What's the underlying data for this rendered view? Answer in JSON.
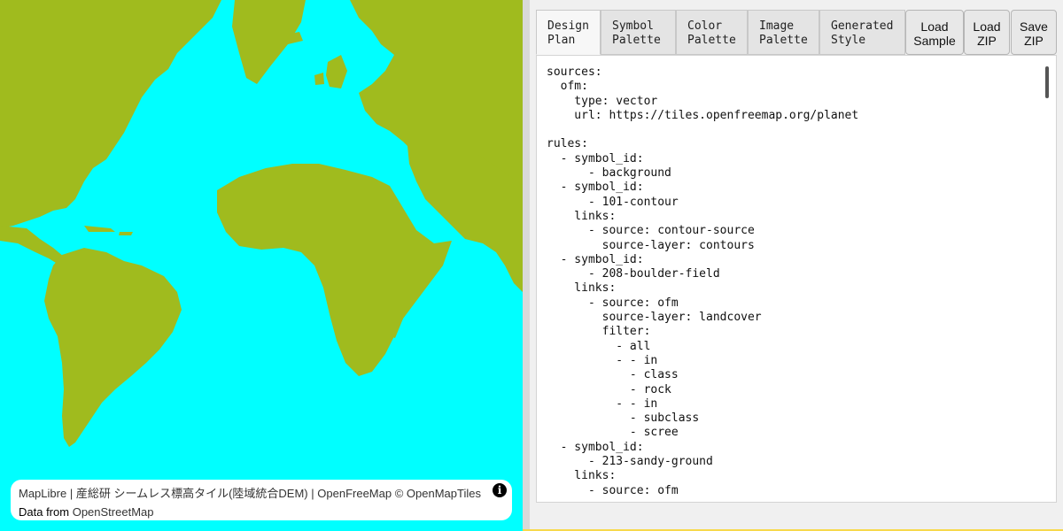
{
  "map": {
    "attribution_line1": [
      "MapLibre",
      "産総研 シームレス標高タイル(陸域統合DEM)",
      "OpenFreeMap",
      "© OpenMapTiles"
    ],
    "separator": "|",
    "data_from_label": "Data from",
    "data_from_link": "OpenStreetMap",
    "info_icon": "i",
    "colors": {
      "water": "#00ffff",
      "land": "#a0bb1e"
    }
  },
  "panel": {
    "tabs": [
      {
        "label": "Design\nPlan",
        "active": true
      },
      {
        "label": "Symbol\nPalette",
        "active": false
      },
      {
        "label": "Color\nPalette",
        "active": false
      },
      {
        "label": "Image\nPalette",
        "active": false
      },
      {
        "label": "Generated\nStyle",
        "active": false
      }
    ],
    "buttons": {
      "load_sample": "Load\nSample",
      "load_zip": "Load\nZIP",
      "save_zip": "Save\nZIP"
    },
    "editor_text": "sources:\n  ofm:\n    type: vector\n    url: https://tiles.openfreemap.org/planet\n\nrules:\n  - symbol_id:\n      - background\n  - symbol_id:\n      - 101-contour\n    links:\n      - source: contour-source\n        source-layer: contours\n  - symbol_id:\n      - 208-boulder-field\n    links:\n      - source: ofm\n        source-layer: landcover\n        filter:\n          - all\n          - - in\n            - class\n            - rock\n          - - in\n            - subclass\n            - scree\n  - symbol_id:\n      - 213-sandy-ground\n    links:\n      - source: ofm"
  }
}
